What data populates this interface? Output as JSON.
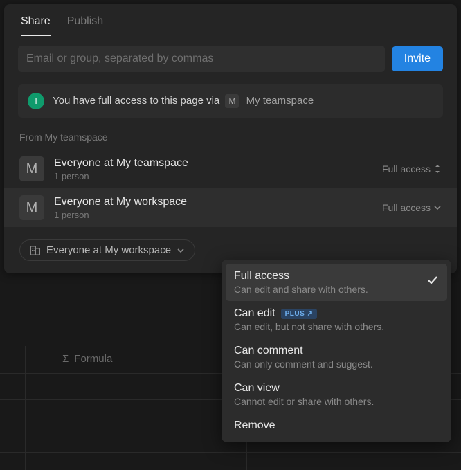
{
  "tabs": {
    "share": "Share",
    "publish": "Publish"
  },
  "invite": {
    "placeholder": "Email or group, separated by commas",
    "button": "Invite"
  },
  "banner": {
    "avatar_initial": "I",
    "text": "You have full access to this page via",
    "badge": "M",
    "link": "My teamspace"
  },
  "section_title": "From My teamspace",
  "rows": [
    {
      "avatar": "M",
      "title": "Everyone at My teamspace",
      "subtitle": "1 person",
      "access": "Full access"
    },
    {
      "avatar": "M",
      "title": "Everyone at My workspace",
      "subtitle": "1 person",
      "access": "Full access"
    }
  ],
  "scope_pill": "Everyone at My workspace",
  "bg_column": "Formula",
  "dropdown": {
    "items": [
      {
        "title": "Full access",
        "sub": "Can edit and share with others.",
        "selected": true
      },
      {
        "title": "Can edit",
        "sub": "Can edit, but not share with others.",
        "badge": "PLUS ↗"
      },
      {
        "title": "Can comment",
        "sub": "Can only comment and suggest."
      },
      {
        "title": "Can view",
        "sub": "Cannot edit or share with others."
      },
      {
        "title": "Remove"
      }
    ]
  }
}
